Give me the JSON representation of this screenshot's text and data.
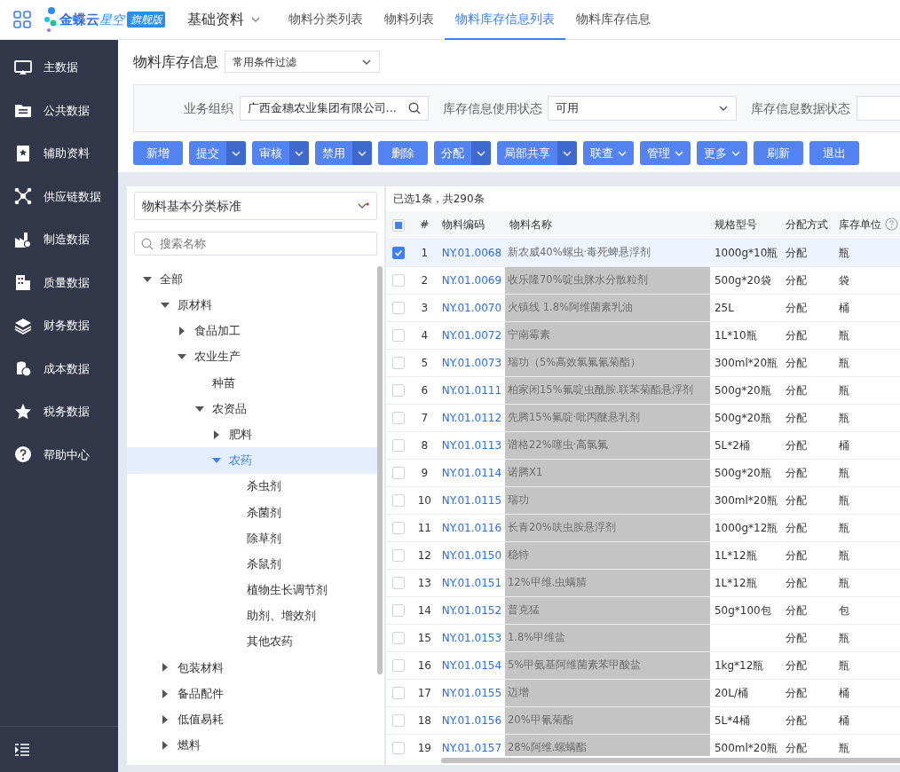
{
  "topbar": {
    "logo": {
      "name": "金蝶云",
      "product": "星空",
      "edition": "旗舰版"
    },
    "module": "基础资料",
    "tabs": [
      {
        "label": "物料分类列表",
        "selected": false
      },
      {
        "label": "物料列表",
        "selected": false
      },
      {
        "label": "物料库存信息列表",
        "selected": true
      },
      {
        "label": "物料库存信息",
        "selected": false
      }
    ]
  },
  "sidebar": {
    "items": [
      {
        "label": "主数据"
      },
      {
        "label": "公共数据"
      },
      {
        "label": "辅助资料"
      },
      {
        "label": "供应链数据"
      },
      {
        "label": "制造数据"
      },
      {
        "label": "质量数据"
      },
      {
        "label": "财务数据"
      },
      {
        "label": "成本数据"
      },
      {
        "label": "税务数据"
      },
      {
        "label": "帮助中心"
      }
    ]
  },
  "page": {
    "title": "物料库存信息",
    "scheme": "常用条件过滤"
  },
  "filters": [
    {
      "label": "业务组织",
      "value": "广西金穗农业集团有限公司...",
      "kind": "lookup"
    },
    {
      "label": "库存信息使用状态",
      "value": "可用",
      "kind": "select"
    },
    {
      "label": "库存信息数据状态",
      "kind": "cut"
    }
  ],
  "toolbar": [
    {
      "label": "新增",
      "kind": "plain"
    },
    {
      "label": "提交",
      "kind": "split"
    },
    {
      "label": "审核",
      "kind": "split"
    },
    {
      "label": "禁用",
      "kind": "split"
    },
    {
      "label": "删除",
      "kind": "plain"
    },
    {
      "label": "分配",
      "kind": "split"
    },
    {
      "label": "局部共享",
      "kind": "split"
    },
    {
      "label": "联查",
      "kind": "dropdown"
    },
    {
      "label": "管理",
      "kind": "dropdown"
    },
    {
      "label": "更多",
      "kind": "dropdown"
    },
    {
      "label": "刷新",
      "kind": "plain"
    },
    {
      "label": "退出",
      "kind": "plain"
    }
  ],
  "tree_panel": {
    "standard": "物料基本分类标准",
    "search_placeholder": "搜索名称",
    "tree": [
      {
        "label": "全部",
        "expanded": true,
        "selected": false,
        "children": [
          {
            "label": "原材料",
            "expanded": true,
            "selected": false,
            "children": [
              {
                "label": "食品加工",
                "expanded": false,
                "selected": false
              },
              {
                "label": "农业生产",
                "expanded": true,
                "selected": false,
                "children": [
                  {
                    "label": "种苗",
                    "selected": false
                  },
                  {
                    "label": "农资品",
                    "expanded": true,
                    "selected": false,
                    "children": [
                      {
                        "label": "肥料",
                        "expanded": false,
                        "selected": false
                      },
                      {
                        "label": "农药",
                        "expanded": true,
                        "selected": true,
                        "children": [
                          {
                            "label": "杀虫剂",
                            "selected": false
                          },
                          {
                            "label": "杀菌剂",
                            "selected": false
                          },
                          {
                            "label": "除草剂",
                            "selected": false
                          },
                          {
                            "label": "杀鼠剂",
                            "selected": false
                          },
                          {
                            "label": "植物生长调节剂",
                            "selected": false
                          },
                          {
                            "label": "助剂、增效剂",
                            "selected": false
                          },
                          {
                            "label": "其他农药",
                            "selected": false
                          }
                        ]
                      }
                    ]
                  }
                ]
              }
            ]
          },
          {
            "label": "包装材料",
            "expanded": false,
            "selected": false
          },
          {
            "label": "备品配件",
            "expanded": false,
            "selected": false
          },
          {
            "label": "低值易耗",
            "expanded": false,
            "selected": false
          },
          {
            "label": "燃料",
            "expanded": false,
            "selected": false
          }
        ]
      }
    ]
  },
  "table": {
    "summary": "已选1条，共290条",
    "select_all_indeterminate": true,
    "columns": [
      "#",
      "物料编码",
      "物料名称",
      "规格型号",
      "分配方式",
      "库存单位"
    ],
    "rows": [
      {
        "n": "1",
        "code": "NY.01.0068",
        "name": "新农威40%螺虫·毒死蜱悬浮剂",
        "spec": "1000g*10瓶",
        "method": "分配",
        "unit": "瓶",
        "selected": true
      },
      {
        "n": "2",
        "code": "NY.01.0069",
        "name": "收乐隆70%啶虫脒水分散粒剂",
        "spec": "500g*20袋",
        "method": "分配",
        "unit": "袋",
        "selected": false
      },
      {
        "n": "3",
        "code": "NY.01.0070",
        "name": "火镇线 1.8%阿维菌素乳油",
        "spec": "25L",
        "method": "分配",
        "unit": "桶",
        "selected": false
      },
      {
        "n": "4",
        "code": "NY.01.0072",
        "name": "宁南霉素",
        "spec": "1L*10瓶",
        "method": "分配",
        "unit": "瓶",
        "selected": false
      },
      {
        "n": "5",
        "code": "NY.01.0073",
        "name": "瑞功（5%高效氯氟氰菊酯）",
        "spec": "300ml*20瓶",
        "method": "分配",
        "unit": "瓶",
        "selected": false
      },
      {
        "n": "6",
        "code": "NY.01.0111",
        "name": "柏家闲15%氟啶虫酰胺.联苯菊酯悬浮剂",
        "spec": "500g*20瓶",
        "method": "分配",
        "unit": "瓶",
        "selected": false
      },
      {
        "n": "7",
        "code": "NY.01.0112",
        "name": "先腾15%氟啶·吡丙醚悬乳剂",
        "spec": "500g*20瓶",
        "method": "分配",
        "unit": "瓶",
        "selected": false
      },
      {
        "n": "8",
        "code": "NY.01.0113",
        "name": "谱格22%噻虫·高氯氟",
        "spec": "5L*2桶",
        "method": "分配",
        "unit": "桶",
        "selected": false
      },
      {
        "n": "9",
        "code": "NY.01.0114",
        "name": "诺腾X1",
        "spec": "500g*20瓶",
        "method": "分配",
        "unit": "瓶",
        "selected": false
      },
      {
        "n": "10",
        "code": "NY.01.0115",
        "name": "瑞功",
        "spec": "300ml*20瓶",
        "method": "分配",
        "unit": "瓶",
        "selected": false
      },
      {
        "n": "11",
        "code": "NY.01.0116",
        "name": "长青20%呋虫胺悬浮剂",
        "spec": "1000g*12瓶",
        "method": "分配",
        "unit": "瓶",
        "selected": false
      },
      {
        "n": "12",
        "code": "NY.01.0150",
        "name": "稳特",
        "spec": "1L*12瓶",
        "method": "分配",
        "unit": "瓶",
        "selected": false
      },
      {
        "n": "13",
        "code": "NY.01.0151",
        "name": "12%甲维.虫螨腈",
        "spec": "1L*12瓶",
        "method": "分配",
        "unit": "瓶",
        "selected": false
      },
      {
        "n": "14",
        "code": "NY.01.0152",
        "name": "普克猛",
        "spec": "50g*100包",
        "method": "分配",
        "unit": "包",
        "selected": false
      },
      {
        "n": "15",
        "code": "NY.01.0153",
        "name": "1.8%甲维盐",
        "method": "分配",
        "unit": "瓶",
        "selected": false
      },
      {
        "n": "16",
        "code": "NY.01.0154",
        "name": "5%甲氨基阿维菌素苯甲酸盐",
        "spec": "1kg*12瓶",
        "method": "分配",
        "unit": "瓶",
        "selected": false
      },
      {
        "n": "17",
        "code": "NY.01.0155",
        "name": "迈增",
        "spec": "20L/桶",
        "method": "分配",
        "unit": "桶",
        "selected": false
      },
      {
        "n": "18",
        "code": "NY.01.0156",
        "name": "20%甲氰菊酯",
        "spec": "5L*4桶",
        "method": "分配",
        "unit": "桶",
        "selected": false
      },
      {
        "n": "19",
        "code": "NY.01.0157",
        "name": "28%阿维.螺螨酯",
        "spec": "500ml*20瓶",
        "method": "分配",
        "unit": "瓶",
        "selected": false
      }
    ]
  }
}
